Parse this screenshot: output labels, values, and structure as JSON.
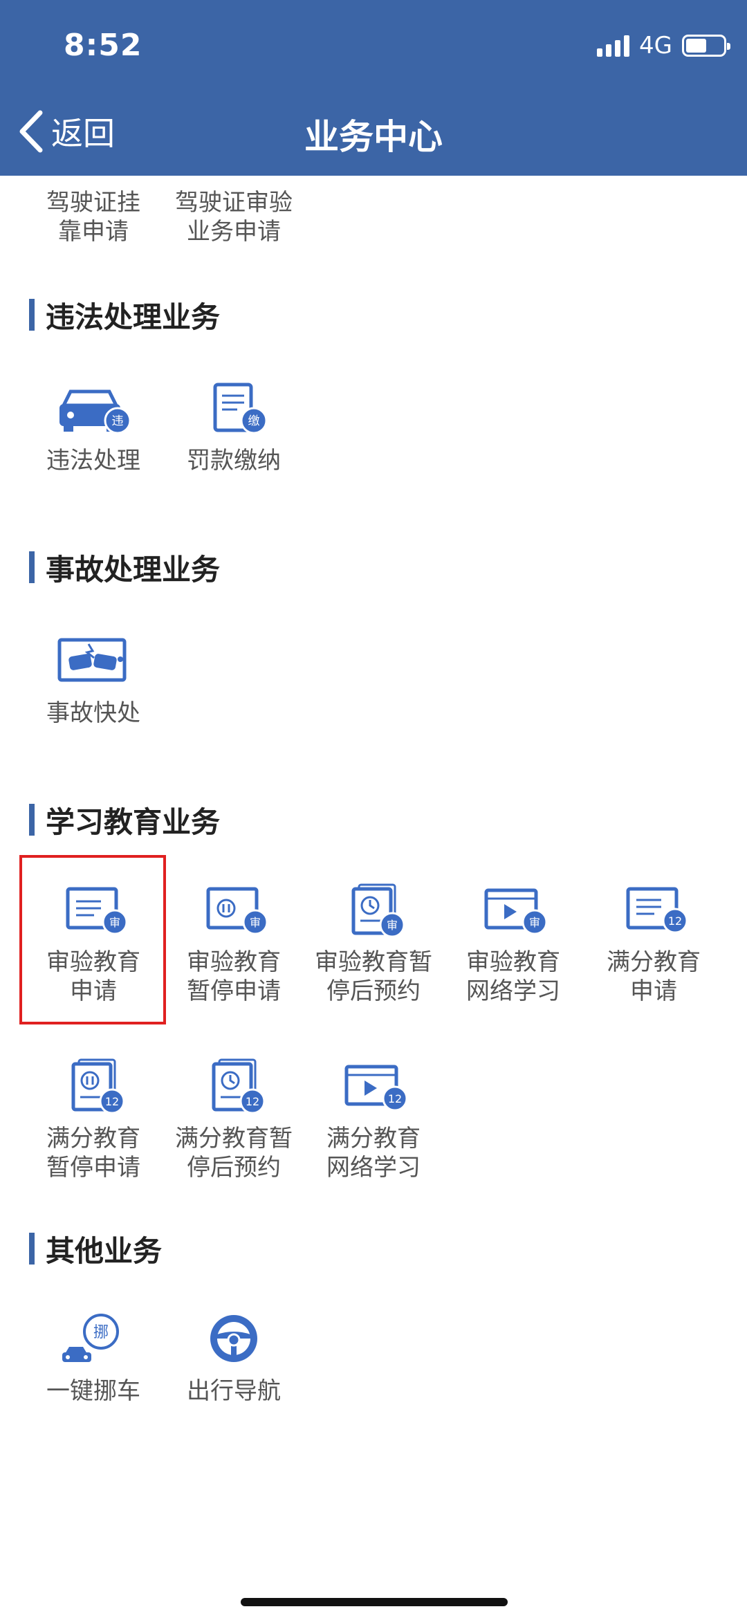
{
  "status_bar": {
    "time": "8:52",
    "network": "4G"
  },
  "nav": {
    "back_label": "返回",
    "title": "业务中心"
  },
  "top_partial": {
    "items": [
      {
        "label": "驾驶证挂\n靠申请"
      },
      {
        "label": "驾驶证审验\n业务申请"
      }
    ]
  },
  "sections": [
    {
      "title": "违法处理业务",
      "items": [
        {
          "label": "违法处理",
          "icon": "car-violation-icon",
          "badge": "违"
        },
        {
          "label": "罚款缴纳",
          "icon": "fine-payment-icon",
          "badge": "缴"
        }
      ]
    },
    {
      "title": "事故处理业务",
      "items": [
        {
          "label": "事故快处",
          "icon": "accident-quick-icon"
        }
      ]
    },
    {
      "title": "学习教育业务",
      "items": [
        {
          "label": "审验教育\n申请",
          "icon": "document-review-icon",
          "badge": "审"
        },
        {
          "label": "审验教育\n暂停申请",
          "icon": "pause-review-icon",
          "badge": "审"
        },
        {
          "label": "审验教育暂\n停后预约",
          "icon": "clock-review-icon",
          "badge": "审"
        },
        {
          "label": "审验教育\n网络学习",
          "icon": "video-review-icon",
          "badge": "审"
        },
        {
          "label": "满分教育\n申请",
          "icon": "document-12-icon",
          "badge": "12"
        },
        {
          "label": "满分教育\n暂停申请",
          "icon": "pause-12-icon",
          "badge": "12"
        },
        {
          "label": "满分教育暂\n停后预约",
          "icon": "clock-12-icon",
          "badge": "12"
        },
        {
          "label": "满分教育\n网络学习",
          "icon": "video-12-icon",
          "badge": "12"
        }
      ]
    },
    {
      "title": "其他业务",
      "items": [
        {
          "label": "一键挪车",
          "icon": "move-car-icon",
          "badge": "挪"
        },
        {
          "label": "出行导航",
          "icon": "steering-wheel-icon"
        }
      ]
    }
  ],
  "colors": {
    "header": "#3c65a6",
    "icon_blue": "#3b6cc4",
    "highlight": "#e02020"
  }
}
